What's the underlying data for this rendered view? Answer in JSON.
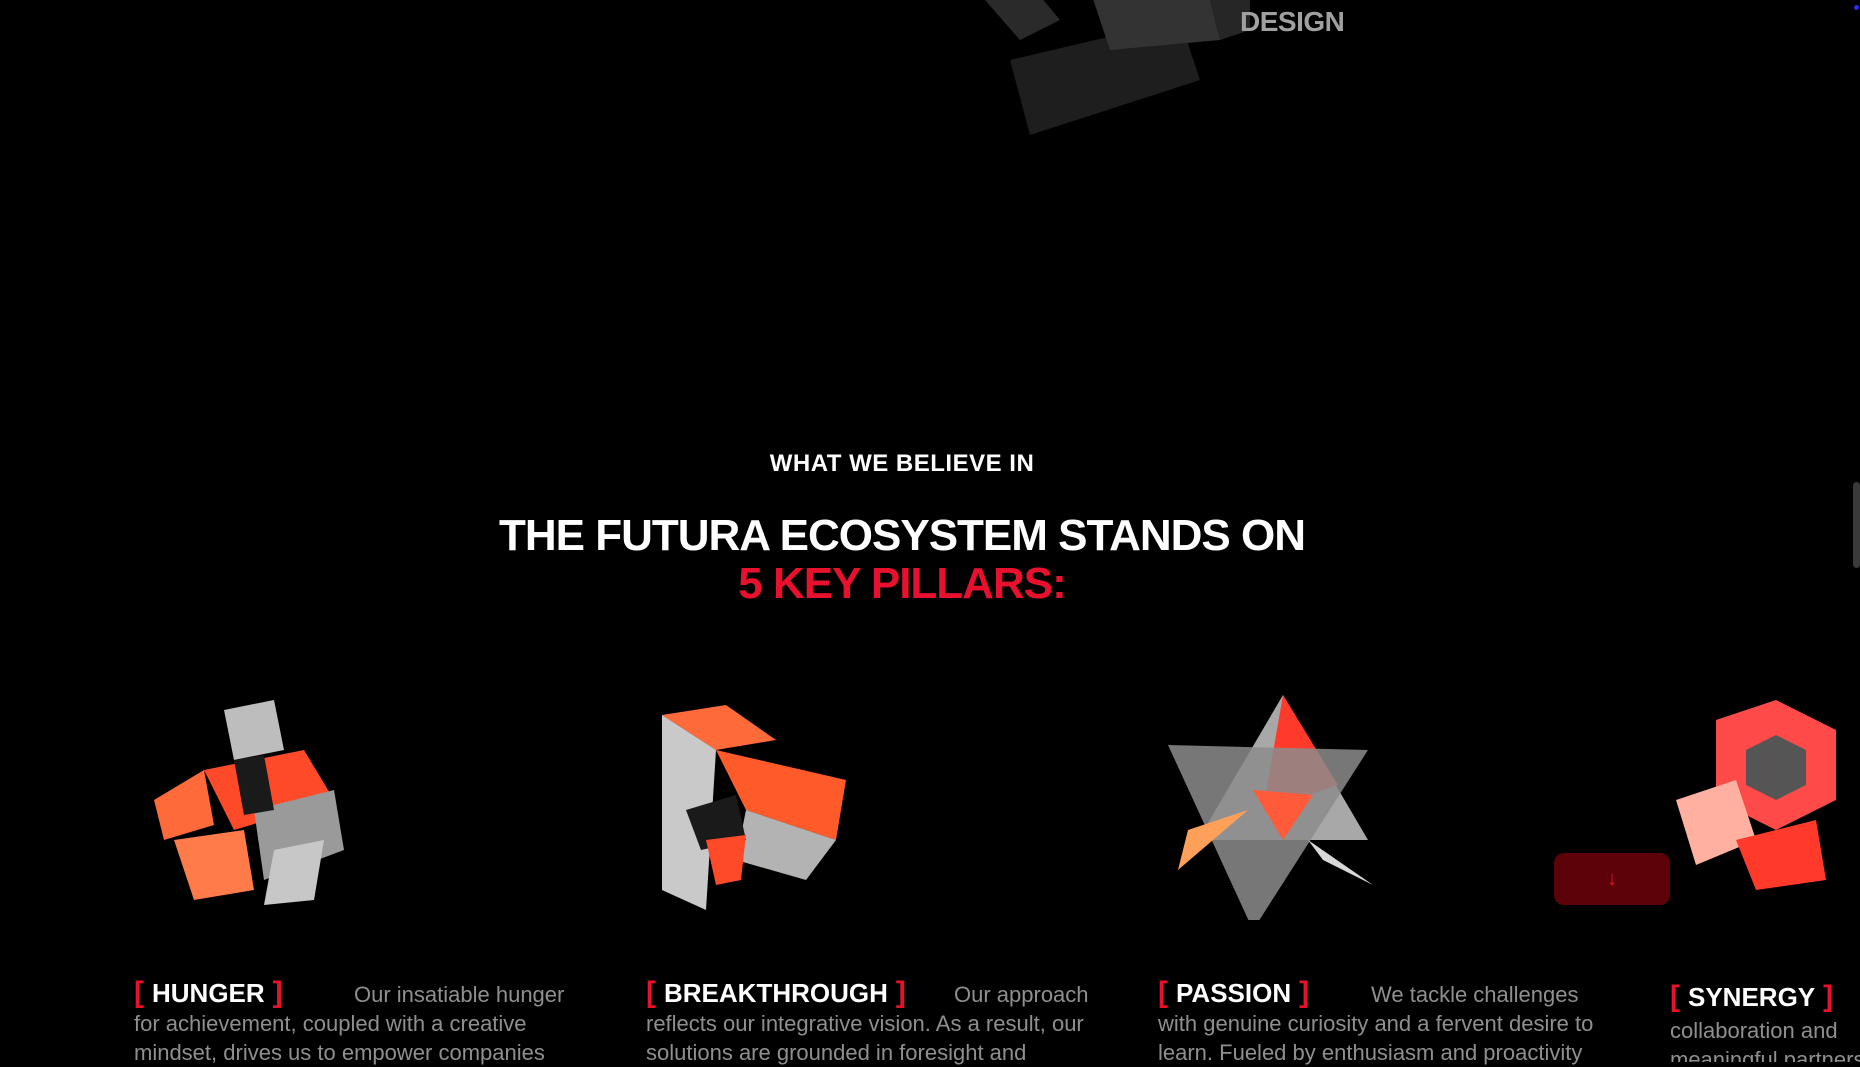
{
  "header": {
    "design_label": "DESIGN"
  },
  "section": {
    "eyebrow": "WHAT WE BELIEVE IN",
    "headline_line1": "THE FUTURA ECOSYSTEM STANDS ON",
    "headline_line2": "5 KEY PILLARS:"
  },
  "pillars": [
    {
      "name": "HUNGER",
      "icon": "crossed-cube-icon",
      "description": "Our insatiable hunger for achievement, coupled with a creative mindset, drives us to empower companies"
    },
    {
      "name": "BREAKTHROUGH",
      "icon": "impossible-triangle-icon",
      "description": "Our approach reflects our integrative vision. As a result, our solutions are grounded in foresight and"
    },
    {
      "name": "PASSION",
      "icon": "star-tetrahedron-icon",
      "description": "We tackle challenges with genuine curiosity and a fervent desire to learn. Fueled by enthusiasm and proactivity"
    },
    {
      "name": "SYNERGY",
      "icon": "hexagon-knot-icon",
      "description": "collaboration and meaningful partnerships, diligence"
    }
  ],
  "controls": {
    "scroll_down_icon": "arrow-down-icon",
    "scroll_down_glyph": "↓"
  },
  "colors": {
    "accent": "#e8112d",
    "background": "#000000",
    "muted_text": "#8f8f8f"
  }
}
